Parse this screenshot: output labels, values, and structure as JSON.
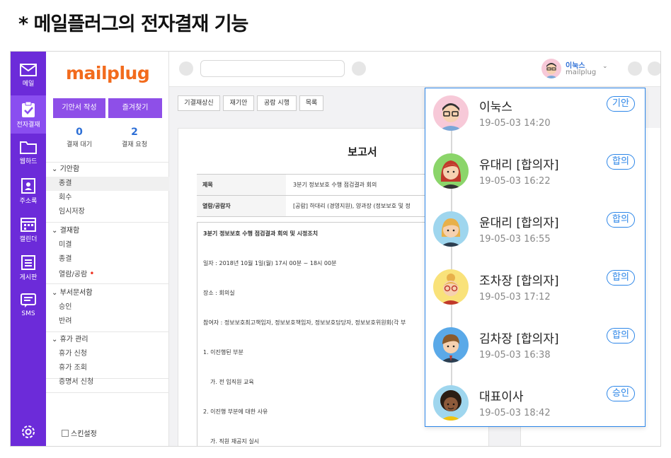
{
  "heading": "* 메일플러그의 전자결재 기능",
  "rail": [
    {
      "label": "메일",
      "icon": "mail-icon"
    },
    {
      "label": "전자결재",
      "icon": "approval-clipboard-icon"
    },
    {
      "label": "웹하드",
      "icon": "folder-icon"
    },
    {
      "label": "주소록",
      "icon": "contact-book-icon"
    },
    {
      "label": "캘린더",
      "icon": "calendar-icon"
    },
    {
      "label": "게시판",
      "icon": "board-icon"
    },
    {
      "label": "SMS",
      "icon": "sms-icon"
    }
  ],
  "logo": "mailplug",
  "menu": {
    "write_button": "기안서 작성",
    "favorites_button": "즐겨찾기",
    "waiting": {
      "count": "0",
      "label": "결재 대기"
    },
    "requested": {
      "count": "2",
      "label": "결재 요청"
    },
    "groups": [
      {
        "title": "기안함",
        "items": [
          "종결",
          "회수",
          "임시저장"
        ]
      },
      {
        "title": "결재함",
        "items": [
          "미결",
          "종결",
          "열람/공람"
        ]
      },
      {
        "title": "부서문서함",
        "items": [
          "승인",
          "반려"
        ]
      },
      {
        "title": "휴가 관리",
        "items": [
          "휴가 신청",
          "휴가 조회"
        ]
      }
    ],
    "certificate": "증명서 신청",
    "skin": "스킨설정"
  },
  "header": {
    "user_name": "이눅스",
    "user_org": "mailplug"
  },
  "toolbar": [
    "기결재상신",
    "재기안",
    "공람 시행",
    "목록"
  ],
  "document": {
    "title": "보고서",
    "subject_label": "제목",
    "subject_value": "3분기 정보보호 수행 점검결과 회의",
    "viewers_label": "열람/공람자",
    "viewers_value": "[공람] 하대리 (경영지원), 양과장 (정보보호 및 정",
    "body": [
      "3분기 정보보호 수행 점검결과 회의 및 시정조치",
      "일자 : 2018년 10월 1일(월) 17시 00분 ~ 18시 00분",
      "장소 : 회의실",
      "참여자 : 정보보호최고책임자, 정보보호책임자, 정보보호담당자, 정보보호위원회(각 부",
      "1. 이진행된 부분",
      "가. 전 임직원 교육",
      "2. 이진행 부분에 대한 사유",
      "가. 직원 재공지 실시"
    ]
  },
  "approvals": [
    {
      "name": "이눅스",
      "time": "19-05-03  14:20",
      "status": "기안",
      "avatar": "man-glasses-avatar-icon",
      "bg": "#f7c9d8"
    },
    {
      "name": "유대리 [합의자]",
      "time": "19-05-03  16:22",
      "status": "합의",
      "avatar": "woman-red-hair-avatar-icon",
      "bg": "#8bd56a"
    },
    {
      "name": "윤대리 [합의자]",
      "time": "19-05-03  16:55",
      "status": "합의",
      "avatar": "woman-blonde-avatar-icon",
      "bg": "#9fd6ee"
    },
    {
      "name": "조차장 [합의자]",
      "time": "19-05-03  17:12",
      "status": "합의",
      "avatar": "woman-glasses-avatar-icon",
      "bg": "#f9e27a"
    },
    {
      "name": "김차장 [합의자]",
      "time": "19-05-03  16:38",
      "status": "합의",
      "avatar": "man-brown-hair-avatar-icon",
      "bg": "#5aa9e8"
    },
    {
      "name": "대표이사",
      "time": "19-05-03  18:42",
      "status": "승인",
      "avatar": "woman-curly-hair-avatar-icon",
      "bg": "#9fd6ee"
    }
  ],
  "colors": {
    "rail": "#6c2bd9",
    "accent": "#2d86e8",
    "logo": "#f26b1d",
    "button": "#8e4fe8"
  }
}
